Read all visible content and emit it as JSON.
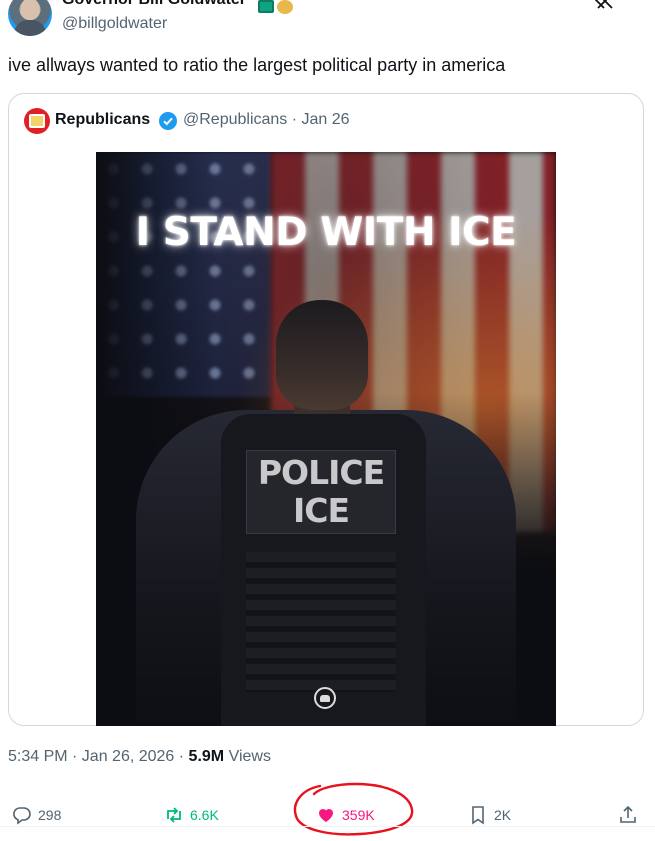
{
  "author": {
    "display_name": "Governor Bill Goldwater",
    "handle": "@billgoldwater"
  },
  "tweet": {
    "text": "ive allways wanted to ratio the largest political party in america"
  },
  "quoted": {
    "name": "Republicans",
    "handle_date": "@Republicans · Jan 26",
    "image": {
      "headline": "I STAND WITH ICE",
      "patch_line1": "POLICE",
      "patch_line2": "ICE"
    }
  },
  "meta": {
    "time_date": "5:34 PM · Jan 26, 2026 · ",
    "views_count": "5.9M",
    "views_label": " Views"
  },
  "actions": {
    "replies": "298",
    "reposts": "6.6K",
    "likes": "359K",
    "bookmarks": "2K"
  },
  "colors": {
    "repost_green": "#00ba7c",
    "like_pink": "#f91880",
    "verified_blue": "#1d9bf0",
    "annotation_red": "#e8121e"
  }
}
